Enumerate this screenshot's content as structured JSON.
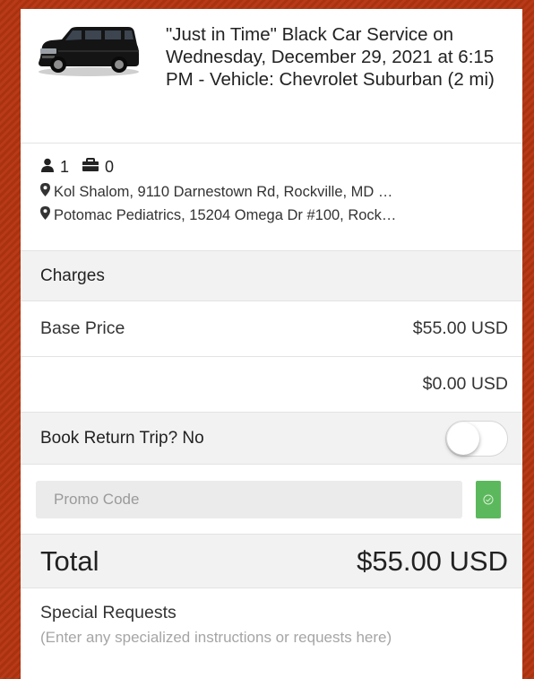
{
  "vehicle": {
    "title": "\"Just in Time\" Black Car Service on Wednesday, December 29, 2021 at 6:15 PM - Vehicle: Chevrolet Suburban (2 mi)",
    "image_icon": "black-suv-icon"
  },
  "trip": {
    "passengers": "1",
    "luggage": "0",
    "pickup": "Kol Shalom, 9110 Darnestown Rd, Rockville, MD …",
    "dropoff": "Potomac Pediatrics, 15204 Omega Dr #100, Rock…"
  },
  "charges": {
    "heading": "Charges",
    "base_label": "Base Price",
    "base_value": "$55.00 USD",
    "extra_value": "$0.00 USD"
  },
  "return_trip": {
    "label": "Book Return Trip? No",
    "enabled": false
  },
  "promo": {
    "placeholder": "Promo Code",
    "value": ""
  },
  "total": {
    "label": "Total",
    "value": "$55.00 USD"
  },
  "special_requests": {
    "label": "Special Requests",
    "placeholder": "(Enter any specialized instructions or requests here)"
  },
  "colors": {
    "background": "#b83a18",
    "apply_button": "#5cb85c"
  }
}
